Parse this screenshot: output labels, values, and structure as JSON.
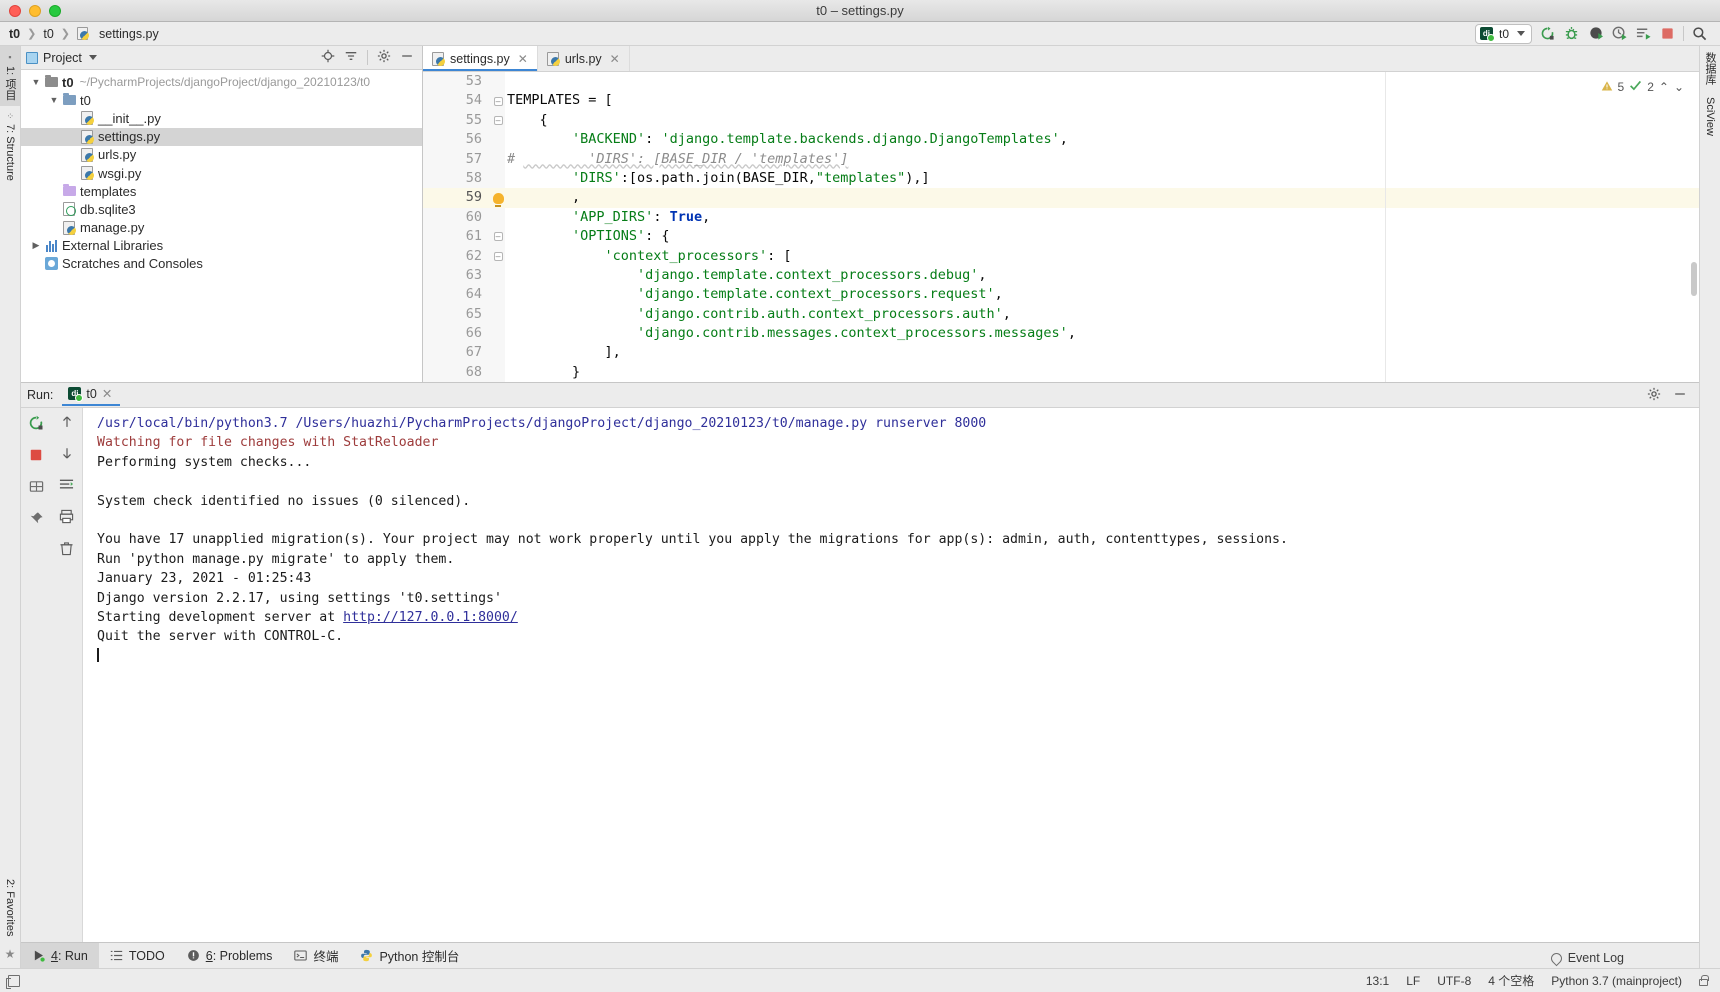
{
  "window": {
    "title": "t0 – settings.py"
  },
  "navbar": {
    "breadcrumbs": [
      "t0",
      "t0",
      "settings.py"
    ],
    "run_config": {
      "name": "t0",
      "badge": "dj"
    },
    "icons": [
      {
        "name": "rerun-icon"
      },
      {
        "name": "debug-icon"
      },
      {
        "name": "run-with-coverage-icon"
      },
      {
        "name": "profile-icon"
      },
      {
        "name": "run-tests-icon"
      },
      {
        "name": "stop-icon"
      },
      {
        "name": "search-everywhere-icon"
      }
    ]
  },
  "left_strip": {
    "top_tabs": [
      {
        "label": "1: 项目",
        "icon": "folder-icon",
        "active": true
      },
      {
        "label": "7: Structure",
        "icon": "structure-icon",
        "active": false
      }
    ],
    "bottom_tabs": [
      {
        "label": "2: Favorites",
        "icon": "star-icon"
      }
    ]
  },
  "right_strip": {
    "tabs": [
      {
        "label": "数据库",
        "icon": "database-icon"
      },
      {
        "label": "SciView",
        "icon": "sciview-icon"
      }
    ]
  },
  "project_panel": {
    "title": "Project",
    "header_icons": [
      "locate-icon",
      "collapse-all-icon",
      "settings-gear-icon",
      "hide-icon"
    ],
    "tree": [
      {
        "depth": 0,
        "arrow": "▼",
        "icon": "folder-icon",
        "label": "t0",
        "bold": true,
        "path": "~/PycharmProjects/djangoProject/django_20210123/t0",
        "selected": false
      },
      {
        "depth": 1,
        "arrow": "▼",
        "icon": "source-folder-icon",
        "label": "t0",
        "bold": false,
        "path": "",
        "selected": false
      },
      {
        "depth": 2,
        "arrow": "",
        "icon": "python-file-icon",
        "label": "__init__.py",
        "bold": false,
        "path": "",
        "selected": false
      },
      {
        "depth": 2,
        "arrow": "",
        "icon": "python-file-icon",
        "label": "settings.py",
        "bold": false,
        "path": "",
        "selected": true
      },
      {
        "depth": 2,
        "arrow": "",
        "icon": "python-file-icon",
        "label": "urls.py",
        "bold": false,
        "path": "",
        "selected": false
      },
      {
        "depth": 2,
        "arrow": "",
        "icon": "python-file-icon",
        "label": "wsgi.py",
        "bold": false,
        "path": "",
        "selected": false
      },
      {
        "depth": 1,
        "arrow": "",
        "icon": "templates-folder-icon",
        "label": "templates",
        "bold": false,
        "path": "",
        "selected": false
      },
      {
        "depth": 1,
        "arrow": "",
        "icon": "sqlite-file-icon",
        "label": "db.sqlite3",
        "bold": false,
        "path": "",
        "selected": false
      },
      {
        "depth": 1,
        "arrow": "",
        "icon": "python-file-icon",
        "label": "manage.py",
        "bold": false,
        "path": "",
        "selected": false
      },
      {
        "depth": 0,
        "arrow": "▶",
        "icon": "libraries-icon",
        "label": "External Libraries",
        "bold": false,
        "path": "",
        "selected": false
      },
      {
        "depth": 0,
        "arrow": "",
        "icon": "scratches-icon",
        "label": "Scratches and Consoles",
        "bold": false,
        "path": "",
        "selected": false
      }
    ]
  },
  "editor": {
    "tabs": [
      {
        "label": "settings.py",
        "active": true
      },
      {
        "label": "urls.py",
        "active": false
      }
    ],
    "inspection": {
      "warnings": "5",
      "checks": "2"
    },
    "first_line_number": 53,
    "current_line": 59,
    "lines": [
      {
        "n": 53,
        "fold": "",
        "marker": "",
        "tokens": []
      },
      {
        "n": 54,
        "fold": "-",
        "marker": "",
        "tokens": [
          {
            "t": "plain",
            "v": "TEMPLATES = ["
          }
        ]
      },
      {
        "n": 55,
        "fold": "-",
        "marker": "",
        "tokens": [
          {
            "t": "plain",
            "v": "    {"
          }
        ]
      },
      {
        "n": 56,
        "fold": "",
        "marker": "",
        "tokens": [
          {
            "t": "str",
            "v": "        'BACKEND'"
          },
          {
            "t": "plain",
            "v": ": "
          },
          {
            "t": "str",
            "v": "'django.template.backends.django.DjangoTemplates'"
          },
          {
            "t": "plain",
            "v": ","
          }
        ]
      },
      {
        "n": 57,
        "fold": "",
        "marker": "comment-hash",
        "tokens": [
          {
            "t": "cmt",
            "v": "        'DIRS': [BASE_DIR / 'templates']"
          }
        ]
      },
      {
        "n": 58,
        "fold": "",
        "marker": "",
        "tokens": [
          {
            "t": "str",
            "v": "        'DIRS'"
          },
          {
            "t": "plain",
            "v": ":[os.path.join(BASE_DIR,"
          },
          {
            "t": "str",
            "v": "\"templates\""
          },
          {
            "t": "plain",
            "v": "),]"
          }
        ]
      },
      {
        "n": 59,
        "fold": "",
        "marker": "bulb",
        "tokens": [
          {
            "t": "plain",
            "v": "        ,"
          }
        ]
      },
      {
        "n": 60,
        "fold": "",
        "marker": "",
        "tokens": [
          {
            "t": "str",
            "v": "        'APP_DIRS'"
          },
          {
            "t": "plain",
            "v": ": "
          },
          {
            "t": "kw",
            "v": "True"
          },
          {
            "t": "plain",
            "v": ","
          }
        ]
      },
      {
        "n": 61,
        "fold": "-",
        "marker": "",
        "tokens": [
          {
            "t": "str",
            "v": "        'OPTIONS'"
          },
          {
            "t": "plain",
            "v": ": {"
          }
        ]
      },
      {
        "n": 62,
        "fold": "-",
        "marker": "",
        "tokens": [
          {
            "t": "str",
            "v": "            'context_processors'"
          },
          {
            "t": "plain",
            "v": ": ["
          }
        ]
      },
      {
        "n": 63,
        "fold": "",
        "marker": "",
        "tokens": [
          {
            "t": "str",
            "v": "                'django.template.context_processors.debug'"
          },
          {
            "t": "plain",
            "v": ","
          }
        ]
      },
      {
        "n": 64,
        "fold": "",
        "marker": "",
        "tokens": [
          {
            "t": "str",
            "v": "                'django.template.context_processors.request'"
          },
          {
            "t": "plain",
            "v": ","
          }
        ]
      },
      {
        "n": 65,
        "fold": "",
        "marker": "",
        "tokens": [
          {
            "t": "str",
            "v": "                'django.contrib.auth.context_processors.auth'"
          },
          {
            "t": "plain",
            "v": ","
          }
        ]
      },
      {
        "n": 66,
        "fold": "",
        "marker": "",
        "tokens": [
          {
            "t": "str",
            "v": "                'django.contrib.messages.context_processors.messages'"
          },
          {
            "t": "plain",
            "v": ","
          }
        ]
      },
      {
        "n": 67,
        "fold": "",
        "marker": "",
        "tokens": [
          {
            "t": "plain",
            "v": "            ],"
          }
        ]
      },
      {
        "n": 68,
        "fold": "",
        "marker": "",
        "tokens": [
          {
            "t": "plain",
            "v": "        }"
          }
        ]
      }
    ]
  },
  "run_window": {
    "label": "Run:",
    "tab": {
      "label": "t0",
      "badge": "dj"
    },
    "header_icons": [
      "settings-gear-icon",
      "hide-icon"
    ],
    "side_icons": [
      "rerun-icon",
      "up-arrow-icon",
      "stop-icon",
      "down-arrow-icon",
      "print-layout-icon",
      "soft-wrap-icon",
      "pin-icon",
      "print-icon",
      "trash-icon"
    ],
    "console": [
      {
        "type": "cmd",
        "text": "/usr/local/bin/python3.7 /Users/huazhi/PycharmProjects/djangoProject/django_20210123/t0/manage.py runserver 8000"
      },
      {
        "type": "warn",
        "text": "Watching for file changes with StatReloader"
      },
      {
        "type": "norm",
        "text": "Performing system checks..."
      },
      {
        "type": "norm",
        "text": ""
      },
      {
        "type": "norm",
        "text": "System check identified no issues (0 silenced)."
      },
      {
        "type": "norm",
        "text": ""
      },
      {
        "type": "norm",
        "text": "You have 17 unapplied migration(s). Your project may not work properly until you apply the migrations for app(s): admin, auth, contenttypes, sessions."
      },
      {
        "type": "norm",
        "text": "Run 'python manage.py migrate' to apply them."
      },
      {
        "type": "norm",
        "text": "January 23, 2021 - 01:25:43"
      },
      {
        "type": "norm",
        "text": "Django version 2.2.17, using settings 't0.settings'"
      },
      {
        "type": "link-line",
        "prefix": "Starting development server at ",
        "link": "http://127.0.0.1:8000/"
      },
      {
        "type": "norm",
        "text": "Quit the server with CONTROL-C."
      },
      {
        "type": "caret",
        "text": ""
      }
    ]
  },
  "bottom_tabs": [
    {
      "label": "4: Run",
      "underline": "4",
      "icon": "run-icon",
      "active": true
    },
    {
      "label": "TODO",
      "underline": "",
      "icon": "todo-icon",
      "active": false
    },
    {
      "label": "6: Problems",
      "underline": "6",
      "icon": "problems-icon",
      "active": false
    },
    {
      "label": "终端",
      "underline": "",
      "icon": "terminal-icon",
      "active": false
    },
    {
      "label": "Python 控制台",
      "underline": "",
      "icon": "python-console-icon",
      "active": false
    }
  ],
  "bottom_right": {
    "event_log": "Event Log"
  },
  "statusbar": {
    "position": "13:1",
    "line_separator": "LF",
    "encoding": "UTF-8",
    "indent": "4 个空格",
    "interpreter": "Python 3.7 (mainproject)"
  },
  "colors": {
    "accent": "#3d86d4",
    "string": "#067d17",
    "keyword": "#0033b3",
    "warn": "#9d3b3b",
    "link": "#2f2f9a",
    "selection": "#d4d4d4",
    "current_line": "#fcf9e8"
  }
}
